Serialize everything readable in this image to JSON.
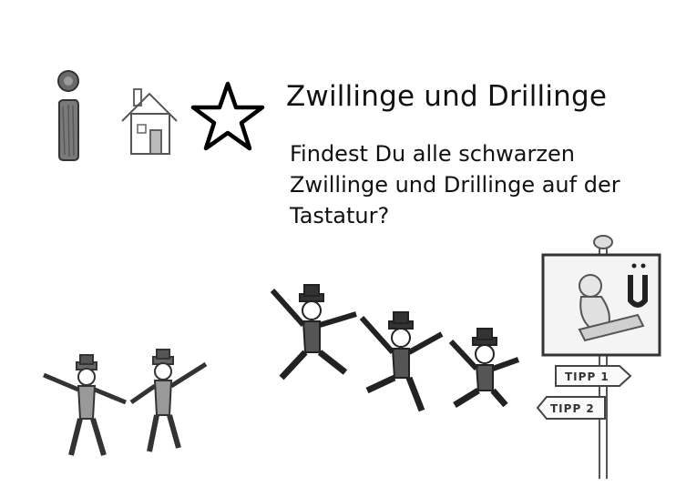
{
  "task": {
    "title": "Zwillinge und Drillinge",
    "description_lines": [
      "Findest Du alle schwarzen",
      "Zwillinge und Drillinge auf der",
      "Tastatur?"
    ]
  },
  "toolbar": {
    "icons": [
      "info-icon",
      "home-icon",
      "star-icon"
    ]
  },
  "hint_sign": {
    "tips": [
      "TIPP 1",
      "TIPP 2"
    ]
  },
  "figures": {
    "twins_count": 2,
    "triplets_count": 3
  },
  "colors": {
    "ink": "#111111",
    "pencil": "#555555",
    "background": "#ffffff"
  }
}
